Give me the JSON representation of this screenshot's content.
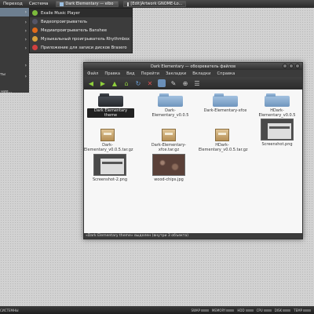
{
  "top_panel": {
    "menus": [
      "Переход",
      "Система"
    ],
    "tasks": [
      {
        "label": "Dark Elementary — elbo",
        "active": true
      },
      {
        "label": "[Edit]Artwork GNOME-Lo..."
      }
    ]
  },
  "app_menu": {
    "side_label": "ты",
    "footer": "ние...",
    "submenu": [
      {
        "label": "Exaile Music Player",
        "icon": "exaile-icon",
        "color": "#7cbb3c"
      },
      {
        "label": "Видеопроигрыватель",
        "icon": "video-player-icon",
        "color": "#555566"
      },
      {
        "label": "Медиапроигрыватель Banshee",
        "icon": "banshee-icon",
        "color": "#e06a1a"
      },
      {
        "label": "Музыкальный проигрыватель Rhythmbox",
        "icon": "rhythmbox-icon",
        "color": "#d8a23c"
      },
      {
        "label": "Приложение для записи дисков Brasero",
        "icon": "brasero-icon",
        "color": "#d04040"
      }
    ]
  },
  "file_manager": {
    "title": "Dark Elementary — обозреватель файлов",
    "menubar": [
      "Файл",
      "Правка",
      "Вид",
      "Перейти",
      "Закладки",
      "Вкладки",
      "Справка"
    ],
    "items": [
      {
        "label": "Dark Elementary theme",
        "kind": "folder-dark",
        "selected": true
      },
      {
        "label": "Dark-Elementary_v0.0.5",
        "kind": "folder"
      },
      {
        "label": "Dark-Elementary-xfce",
        "kind": "folder"
      },
      {
        "label": "HDark-Elementary_v0.0.5",
        "kind": "folder"
      },
      {
        "label": "Dark-Elementary_v0.0.5.tar.gz",
        "kind": "archive"
      },
      {
        "label": "Dark-Elementary-xfce.tar.gz",
        "kind": "archive"
      },
      {
        "label": "HDark-Elementary_v0.0.5.tar.gz",
        "kind": "archive"
      },
      {
        "label": "Screenshot.png",
        "kind": "shot"
      },
      {
        "label": "Screenshot-2.png",
        "kind": "shot"
      },
      {
        "label": "wood-chips.jpg",
        "kind": "wood"
      }
    ],
    "status": "«Dark Elementary theme» выделен (внутри 3 объекта)"
  },
  "bottom_panel": {
    "monitors": [
      "СИСТЕМНЫ",
      "SWAP",
      "MEMORY",
      "HDD",
      "CPU",
      "DISK",
      "TEMP"
    ]
  }
}
